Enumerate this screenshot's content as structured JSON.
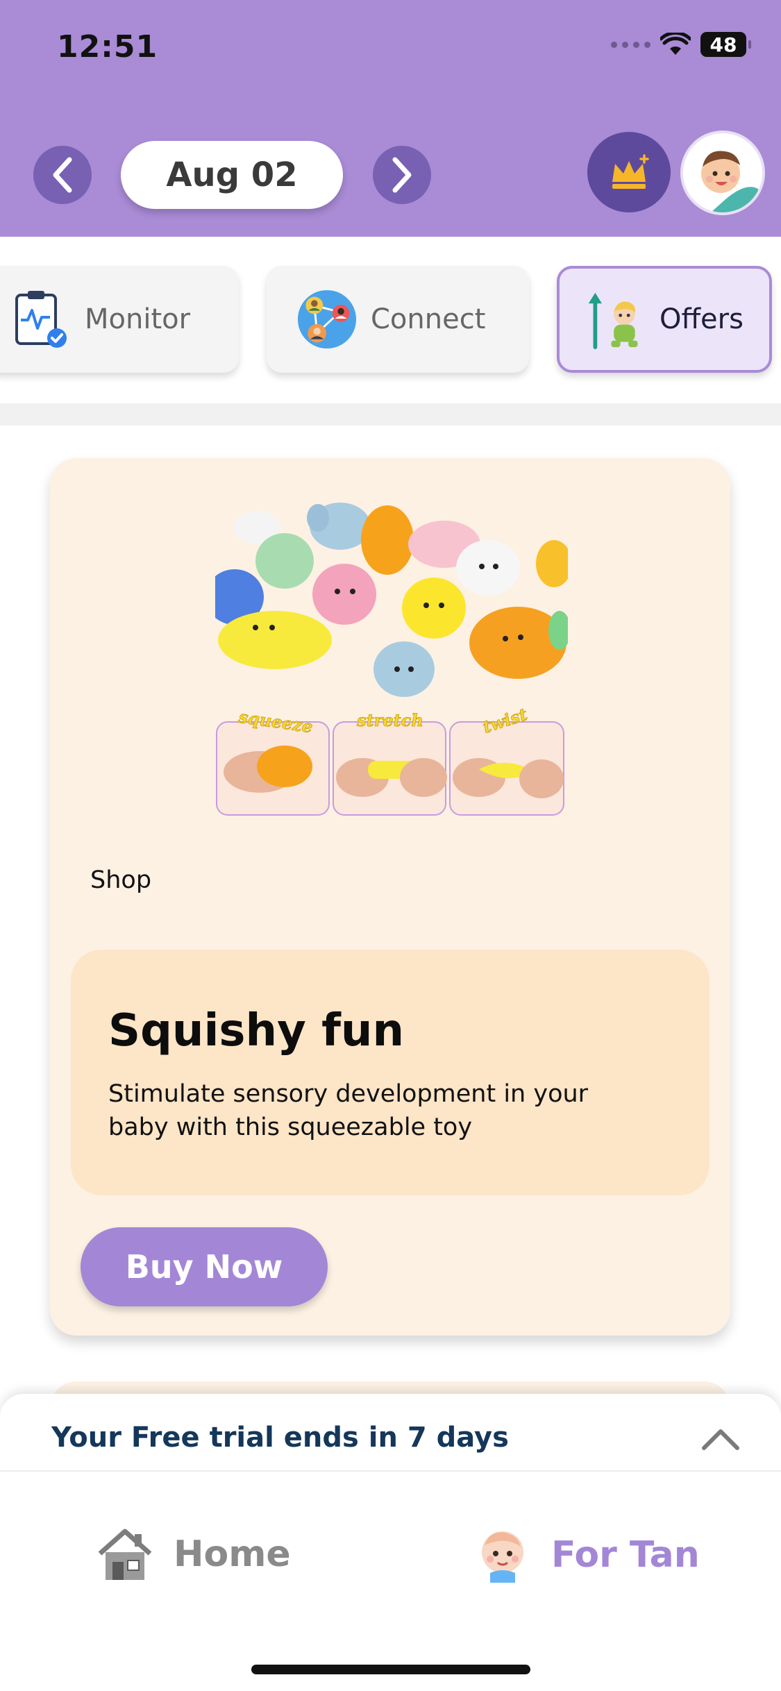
{
  "status_bar": {
    "time": "12:51",
    "battery": "48"
  },
  "header": {
    "date": "Aug 02",
    "icons": {
      "prev": "chevron-left-icon",
      "next": "chevron-right-icon",
      "premium": "crown-icon",
      "profile": "baby-avatar"
    },
    "colors": {
      "background": "#a98bd6",
      "nav_circle": "#7860b3",
      "crown_bg": "#5d4a9c"
    }
  },
  "tabs": [
    {
      "label": "Monitor",
      "icon": "clipboard-health-icon",
      "selected": false
    },
    {
      "label": "Connect",
      "icon": "network-people-icon",
      "selected": false
    },
    {
      "label": "Offers",
      "icon": "growth-baby-icon",
      "selected": true
    }
  ],
  "offer_card": {
    "image_labels": [
      "squeeze",
      "stretch",
      "twist"
    ],
    "category": "Shop",
    "title": "Squishy fun",
    "description": "Stimulate sensory development in your baby with this squeezable toy",
    "cta": "Buy Now",
    "colors": {
      "card": "#fdf1e4",
      "info_box": "#fde5c7",
      "button": "#a387d6"
    }
  },
  "trial_banner": {
    "text": "Your Free trial ends in 7 days",
    "icon": "chevron-up-icon"
  },
  "bottom_nav": {
    "home": {
      "label": "Home",
      "icon": "house-icon"
    },
    "for_tan": {
      "label": "For Tan",
      "icon": "baby-face-icon",
      "active": true
    }
  }
}
